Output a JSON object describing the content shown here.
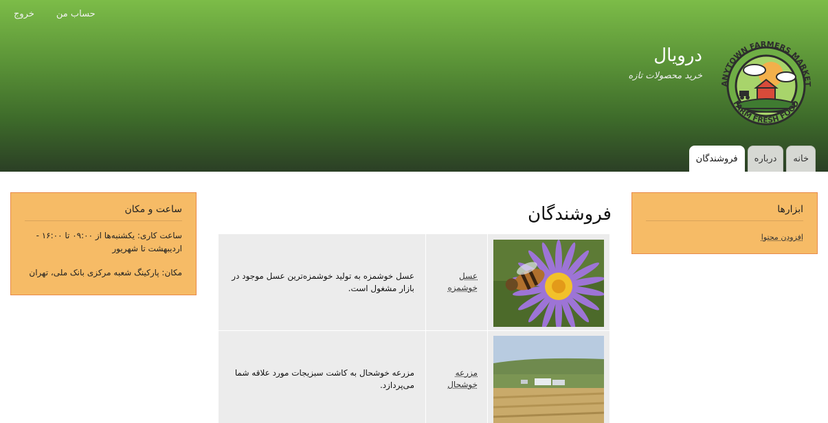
{
  "header": {
    "site_name": "درویال",
    "site_slogan": "خرید محصولات تازه",
    "logo_text_top": "ANYTOWN FARMERS MARKET",
    "logo_text_bottom": "FARM FRESH FOOD",
    "gradient_top": "#7cbc48",
    "gradient_bottom": "#2b3f25"
  },
  "secondary_menu": {
    "logout": "خروج",
    "my_account": "حساب من"
  },
  "tabs": [
    {
      "label": "خانه",
      "active": false
    },
    {
      "label": "درباره",
      "active": false
    },
    {
      "label": "فروشندگان",
      "active": true
    }
  ],
  "tools_block": {
    "title": "ابزارها",
    "add_content": "افزودن محتوا"
  },
  "hours_block": {
    "title": "ساعت و مکان",
    "hours": "ساعت کاری: یکشنبه‌ها از ۰۹:۰۰ تا ۱۶:۰۰ - اردیبهشت تا شهریور",
    "location": "مکان: پارکینگ شعبه مرکزی بانک ملی، تهران"
  },
  "main": {
    "page_title": "فروشندگان",
    "vendors": [
      {
        "name": "عسل خوشمزه",
        "description": "عسل خوشمزه به تولید خوشمزه‌ترین عسل موجود در بازار مشغول است.",
        "image": "bee-on-flower-photo"
      },
      {
        "name": "مزرعه خوشحال",
        "description": "مزرعه خوشحال به کاشت سبزیجات مورد علاقه شما می‌پردازد.",
        "image": "farm-landscape-photo"
      }
    ]
  },
  "colors": {
    "block_bg": "#f6bb66",
    "block_border": "#e8894a",
    "table_bg": "#ececec"
  }
}
